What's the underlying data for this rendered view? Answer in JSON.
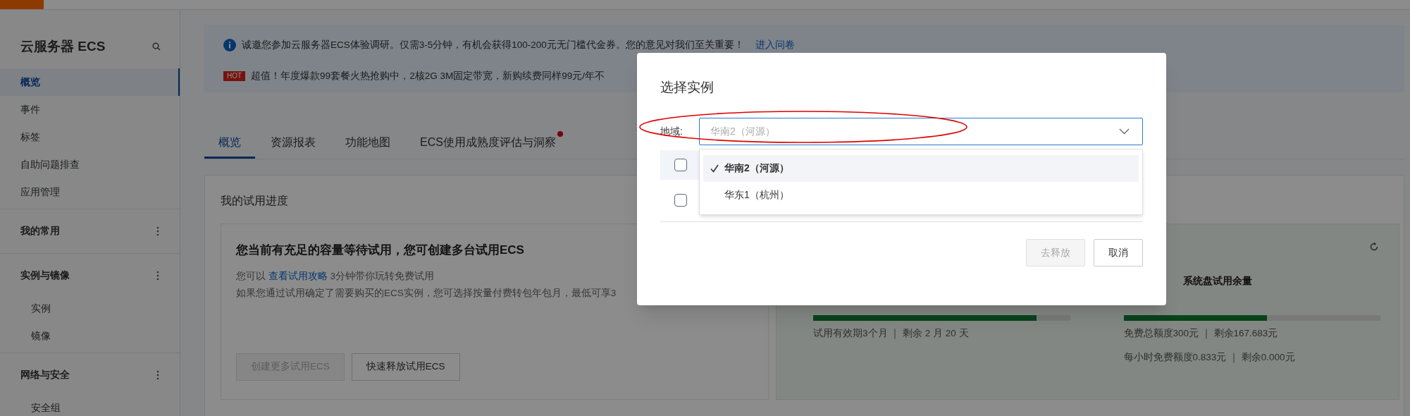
{
  "sidebar": {
    "title": "云服务器 ECS",
    "sections": [
      {
        "items": [
          {
            "label": "概览",
            "selected": true
          },
          {
            "label": "事件",
            "selected": false
          },
          {
            "label": "标签",
            "selected": false
          },
          {
            "label": "自助问题排查",
            "selected": false
          },
          {
            "label": "应用管理",
            "selected": false
          }
        ]
      },
      {
        "title": "我的常用"
      },
      {
        "title": "实例与镜像",
        "items": [
          {
            "label": "实例",
            "selected": false
          },
          {
            "label": "镜像",
            "selected": false
          }
        ]
      },
      {
        "title": "网络与安全",
        "items": [
          {
            "label": "安全组",
            "selected": false
          }
        ]
      }
    ]
  },
  "banner": {
    "notice": {
      "text": "诚邀您参加云服务器ECS体验调研。仅需3-5分钟，有机会获得100-200元无门槛代金券。您的意见对我们至关重要！",
      "link": "进入问卷"
    },
    "promo": {
      "badge": "HOT",
      "text": "超值！年度爆款99套餐火热抢购中，2核2G 3M固定带宽，新购续费同样99元/年不"
    }
  },
  "tabs": [
    {
      "label": "概览",
      "selected": true,
      "dot": false
    },
    {
      "label": "资源报表",
      "selected": false,
      "dot": false
    },
    {
      "label": "功能地图",
      "selected": false,
      "dot": false
    },
    {
      "label": "ECS使用成熟度评估与洞察",
      "selected": false,
      "dot": true
    }
  ],
  "trial": {
    "title": "我的试用进度",
    "card": {
      "heading": "您当前有充足的容量等待试用，您可创建多台试用ECS",
      "intro": "您可以 ",
      "link": "查看试用攻略",
      "intro_end": " 3分钟带你玩转免费试用",
      "note": "如果您通过试用确定了需要购买的ECS实例，您可选择按量付费转包年包月，最低可享3",
      "buttons": [
        {
          "label": "创建更多试用ECS",
          "disabled": true
        },
        {
          "label": "快速释放试用ECS",
          "disabled": false
        }
      ]
    },
    "quota": {
      "metrics": [
        {
          "level": 0.87,
          "captions": [
            "试用有效期3个月 ｜ 剩余 2 月 20 天"
          ]
        },
        {
          "title": "系统盘试用余量",
          "level": 0.557,
          "captions": [
            "免费总额度300元 ｜ 剩余167.683元",
            "每小时免费额度0.833元 ｜ 剩余0.000元"
          ]
        }
      ]
    }
  },
  "dialog": {
    "title": "选择实例",
    "region": {
      "label": "地域:",
      "value": "华南2（河源）"
    },
    "options": [
      {
        "label": "华南2（河源）",
        "selected": true
      },
      {
        "label": "华东1（杭州）",
        "selected": false
      }
    ],
    "table": {
      "header_checked": false,
      "rows": [
        {
          "checked": false
        }
      ]
    },
    "buttons": [
      {
        "label": "去释放",
        "disabled": true
      },
      {
        "label": "取消",
        "disabled": false
      }
    ]
  },
  "annotation": {
    "kind": "ellipse"
  }
}
